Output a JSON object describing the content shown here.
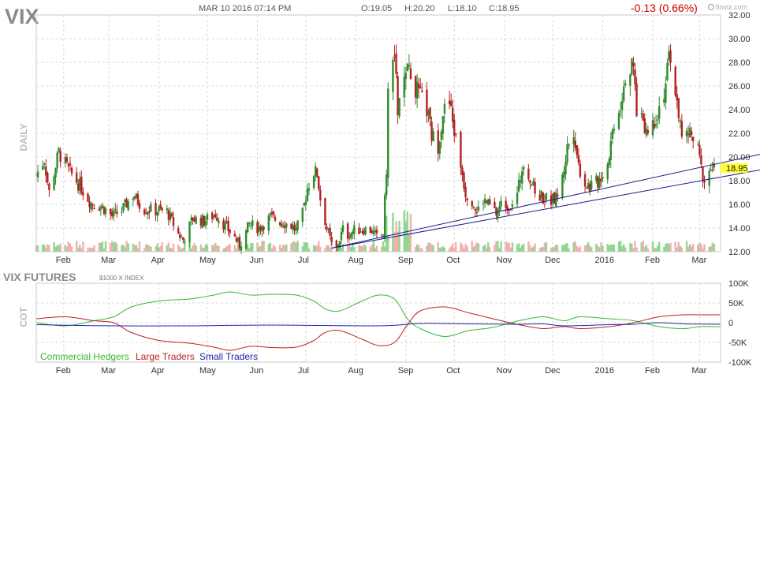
{
  "header": {
    "ticker": "VIX",
    "datetime": "MAR 10 2016 07:14 PM",
    "open": "O:19.05",
    "high": "H:20.20",
    "low": "L:18.10",
    "close": "C:18.95",
    "change": "-0.13 (0.66%)",
    "brand": "finviz.com",
    "change_color": "#cc0000"
  },
  "price_panel": {
    "side_label": "DAILY",
    "y_ticks": [
      "32.00",
      "30.00",
      "28.00",
      "26.00",
      "24.00",
      "22.00",
      "20.00",
      "18.00",
      "16.00",
      "14.00",
      "12.00"
    ],
    "last_price_label": "18.95",
    "x_ticks": [
      "Feb",
      "Mar",
      "Apr",
      "May",
      "Jun",
      "Jul",
      "Aug",
      "Sep",
      "Oct",
      "Nov",
      "Dec",
      "2016",
      "Feb",
      "Mar"
    ]
  },
  "cot_panel": {
    "title": "VIX FUTURES",
    "subtitle": "$1000 X INDEX",
    "side_label": "COT",
    "y_ticks": [
      "100K",
      "50K",
      "0",
      "-50K",
      "-100K"
    ],
    "x_ticks": [
      "Feb",
      "Mar",
      "Apr",
      "May",
      "Jun",
      "Jul",
      "Aug",
      "Sep",
      "Oct",
      "Nov",
      "Dec",
      "2016",
      "Feb",
      "Mar"
    ],
    "legend": {
      "commercial": "Commercial Hedgers",
      "large": "Large Traders",
      "small": "Small Traders"
    }
  },
  "colors": {
    "up": "#2e8b2e",
    "down": "#b22222",
    "vol_up": "#90d890",
    "vol_down": "#f4b0b0",
    "trendline": "#1a1a8c",
    "commercial": "#33bb33",
    "large": "#bb2222",
    "small": "#2222aa",
    "grid": "#d8d8d8",
    "last_price_bg": "#ffff33"
  },
  "chart_data": [
    {
      "type": "candlestick",
      "interval": "daily",
      "y_range": [
        12,
        32
      ],
      "price_anchors": [
        [
          "2015-01-15",
          18.5
        ],
        [
          "2015-01-20",
          19.8
        ],
        [
          "2015-01-23",
          17.0
        ],
        [
          "2015-01-29",
          20.4
        ],
        [
          "2015-02-04",
          18.9
        ],
        [
          "2015-02-11",
          17.6
        ],
        [
          "2015-02-18",
          16.1
        ],
        [
          "2015-02-25",
          15.8
        ],
        [
          "2015-03-03",
          15.0
        ],
        [
          "2015-03-09",
          15.5
        ],
        [
          "2015-03-16",
          16.8
        ],
        [
          "2015-03-23",
          15.6
        ],
        [
          "2015-03-30",
          15.5
        ],
        [
          "2015-04-06",
          15.4
        ],
        [
          "2015-04-13",
          13.5
        ],
        [
          "2015-04-16",
          13.0
        ],
        [
          "2015-04-22",
          14.8
        ],
        [
          "2015-04-29",
          14.6
        ],
        [
          "2015-05-06",
          15.2
        ],
        [
          "2015-05-13",
          14.0
        ],
        [
          "2015-05-18",
          13.2
        ],
        [
          "2015-05-21",
          12.5
        ],
        [
          "2015-05-27",
          14.3
        ],
        [
          "2015-06-02",
          14.0
        ],
        [
          "2015-06-09",
          14.9
        ],
        [
          "2015-06-15",
          14.6
        ],
        [
          "2015-06-22",
          14.2
        ],
        [
          "2015-06-25",
          13.8
        ],
        [
          "2015-06-29",
          15.2
        ],
        [
          "2015-07-02",
          17.4
        ],
        [
          "2015-07-06",
          18.8
        ],
        [
          "2015-07-08",
          18.6
        ],
        [
          "2015-07-10",
          16.5
        ],
        [
          "2015-07-14",
          14.0
        ],
        [
          "2015-07-17",
          12.6
        ],
        [
          "2015-07-20",
          12.2
        ],
        [
          "2015-07-24",
          13.9
        ],
        [
          "2015-07-27",
          13.4
        ],
        [
          "2015-07-31",
          13.8
        ],
        [
          "2015-08-06",
          13.9
        ],
        [
          "2015-08-11",
          13.8
        ],
        [
          "2015-08-14",
          13.2
        ],
        [
          "2015-08-18",
          13.5
        ],
        [
          "2015-08-20",
          19.0
        ],
        [
          "2015-08-21",
          25.0
        ],
        [
          "2015-08-24",
          28.0
        ],
        [
          "2015-08-25",
          28.5
        ],
        [
          "2015-08-27",
          24.0
        ],
        [
          "2015-08-31",
          26.2
        ],
        [
          "2015-09-03",
          27.5
        ],
        [
          "2015-09-08",
          25.5
        ],
        [
          "2015-09-14",
          24.0
        ],
        [
          "2015-09-17",
          21.8
        ],
        [
          "2015-09-21",
          21.0
        ],
        [
          "2015-09-24",
          23.8
        ],
        [
          "2015-09-28",
          24.5
        ],
        [
          "2015-10-01",
          22.2
        ],
        [
          "2015-10-05",
          19.4
        ],
        [
          "2015-10-08",
          17.0
        ],
        [
          "2015-10-12",
          16.4
        ],
        [
          "2015-10-15",
          15.3
        ],
        [
          "2015-10-19",
          16.4
        ],
        [
          "2015-10-22",
          16.0
        ],
        [
          "2015-10-27",
          15.2
        ],
        [
          "2015-10-30",
          16.0
        ],
        [
          "2015-11-04",
          15.9
        ],
        [
          "2015-11-09",
          16.8
        ],
        [
          "2015-11-13",
          19.8
        ],
        [
          "2015-11-16",
          18.6
        ],
        [
          "2015-11-20",
          17.0
        ],
        [
          "2015-11-25",
          16.6
        ],
        [
          "2015-11-30",
          16.3
        ],
        [
          "2015-12-03",
          16.5
        ],
        [
          "2015-12-07",
          18.2
        ],
        [
          "2015-12-10",
          20.8
        ],
        [
          "2015-12-14",
          22.4
        ],
        [
          "2015-12-17",
          19.3
        ],
        [
          "2015-12-21",
          17.8
        ],
        [
          "2015-12-24",
          17.5
        ],
        [
          "2015-12-29",
          17.9
        ],
        [
          "2016-01-04",
          19.5
        ],
        [
          "2016-01-08",
          23.0
        ],
        [
          "2016-01-12",
          24.5
        ],
        [
          "2016-01-15",
          27.0
        ],
        [
          "2016-01-20",
          27.5
        ],
        [
          "2016-01-22",
          24.0
        ],
        [
          "2016-01-26",
          23.2
        ],
        [
          "2016-01-29",
          22.0
        ],
        [
          "2016-02-03",
          23.5
        ],
        [
          "2016-02-08",
          25.5
        ],
        [
          "2016-02-11",
          28.1
        ],
        [
          "2016-02-16",
          25.0
        ],
        [
          "2016-02-19",
          21.5
        ],
        [
          "2016-02-24",
          22.0
        ],
        [
          "2016-02-29",
          20.5
        ],
        [
          "2016-03-02",
          19.0
        ],
        [
          "2016-03-04",
          18.0
        ],
        [
          "2016-03-08",
          19.0
        ],
        [
          "2016-03-10",
          18.95
        ]
      ],
      "last": {
        "date": "2016-03-10",
        "open": 19.05,
        "high": 20.2,
        "low": 18.1,
        "close": 18.95
      },
      "trendlines": [
        {
          "from": [
            "2015-07-17",
            12.3
          ],
          "to": [
            "2016-03-14",
            19.5
          ]
        },
        {
          "from": [
            "2015-07-17",
            12.3
          ],
          "to": [
            "2016-03-14",
            18.3
          ]
        }
      ],
      "volume": "relative bars along the bottom of the price panel; spike in late August 2015"
    },
    {
      "type": "line",
      "title": "VIX FUTURES",
      "y_range": [
        -100000,
        100000
      ],
      "series": [
        {
          "name": "Commercial Hedgers",
          "points": [
            [
              "2015-01-15",
              0
            ],
            [
              "2015-02-02",
              -8000
            ],
            [
              "2015-02-20",
              5000
            ],
            [
              "2015-03-04",
              15000
            ],
            [
              "2015-03-15",
              40000
            ],
            [
              "2015-04-01",
              55000
            ],
            [
              "2015-04-20",
              60000
            ],
            [
              "2015-05-05",
              70000
            ],
            [
              "2015-05-15",
              78000
            ],
            [
              "2015-05-28",
              70000
            ],
            [
              "2015-06-10",
              72000
            ],
            [
              "2015-06-25",
              70000
            ],
            [
              "2015-07-06",
              55000
            ],
            [
              "2015-07-13",
              35000
            ],
            [
              "2015-07-22",
              30000
            ],
            [
              "2015-08-05",
              55000
            ],
            [
              "2015-08-15",
              70000
            ],
            [
              "2015-08-25",
              60000
            ],
            [
              "2015-09-02",
              10000
            ],
            [
              "2015-09-10",
              -15000
            ],
            [
              "2015-09-25",
              -35000
            ],
            [
              "2015-10-10",
              -20000
            ],
            [
              "2015-10-25",
              -12000
            ],
            [
              "2015-11-10",
              5000
            ],
            [
              "2015-11-25",
              15000
            ],
            [
              "2015-12-08",
              5000
            ],
            [
              "2015-12-18",
              15000
            ],
            [
              "2016-01-05",
              10000
            ],
            [
              "2016-01-20",
              5000
            ],
            [
              "2016-02-05",
              -10000
            ],
            [
              "2016-02-20",
              -15000
            ],
            [
              "2016-03-01",
              -10000
            ],
            [
              "2016-03-14",
              -10000
            ]
          ]
        },
        {
          "name": "Large Traders",
          "points": [
            [
              "2015-01-15",
              10000
            ],
            [
              "2015-02-02",
              15000
            ],
            [
              "2015-02-20",
              5000
            ],
            [
              "2015-03-04",
              0
            ],
            [
              "2015-03-15",
              -25000
            ],
            [
              "2015-04-01",
              -45000
            ],
            [
              "2015-04-20",
              -52000
            ],
            [
              "2015-05-05",
              -62000
            ],
            [
              "2015-05-15",
              -70000
            ],
            [
              "2015-05-28",
              -60000
            ],
            [
              "2015-06-10",
              -63000
            ],
            [
              "2015-06-25",
              -62000
            ],
            [
              "2015-07-06",
              -45000
            ],
            [
              "2015-07-13",
              -25000
            ],
            [
              "2015-07-22",
              -20000
            ],
            [
              "2015-08-05",
              -42000
            ],
            [
              "2015-08-15",
              -58000
            ],
            [
              "2015-08-25",
              -50000
            ],
            [
              "2015-09-02",
              -5000
            ],
            [
              "2015-09-10",
              30000
            ],
            [
              "2015-09-25",
              40000
            ],
            [
              "2015-10-10",
              25000
            ],
            [
              "2015-10-25",
              10000
            ],
            [
              "2015-11-10",
              -5000
            ],
            [
              "2015-11-25",
              -15000
            ],
            [
              "2015-12-08",
              -10000
            ],
            [
              "2015-12-18",
              -15000
            ],
            [
              "2016-01-05",
              -10000
            ],
            [
              "2016-01-20",
              0
            ],
            [
              "2016-02-05",
              15000
            ],
            [
              "2016-02-20",
              20000
            ],
            [
              "2016-03-01",
              20000
            ],
            [
              "2016-03-14",
              20000
            ]
          ]
        },
        {
          "name": "Small Traders",
          "points": [
            [
              "2015-01-15",
              -5000
            ],
            [
              "2015-03-04",
              -8000
            ],
            [
              "2015-04-20",
              -8000
            ],
            [
              "2015-06-10",
              -6000
            ],
            [
              "2015-08-15",
              -8000
            ],
            [
              "2015-09-10",
              -2000
            ],
            [
              "2015-10-10",
              -3000
            ],
            [
              "2015-11-10",
              -4000
            ],
            [
              "2015-11-25",
              -3000
            ],
            [
              "2015-12-08",
              -8000
            ],
            [
              "2016-01-05",
              -5000
            ],
            [
              "2016-01-20",
              -4000
            ],
            [
              "2016-02-05",
              0
            ],
            [
              "2016-02-20",
              -3000
            ],
            [
              "2016-03-14",
              -4000
            ]
          ]
        }
      ]
    }
  ]
}
